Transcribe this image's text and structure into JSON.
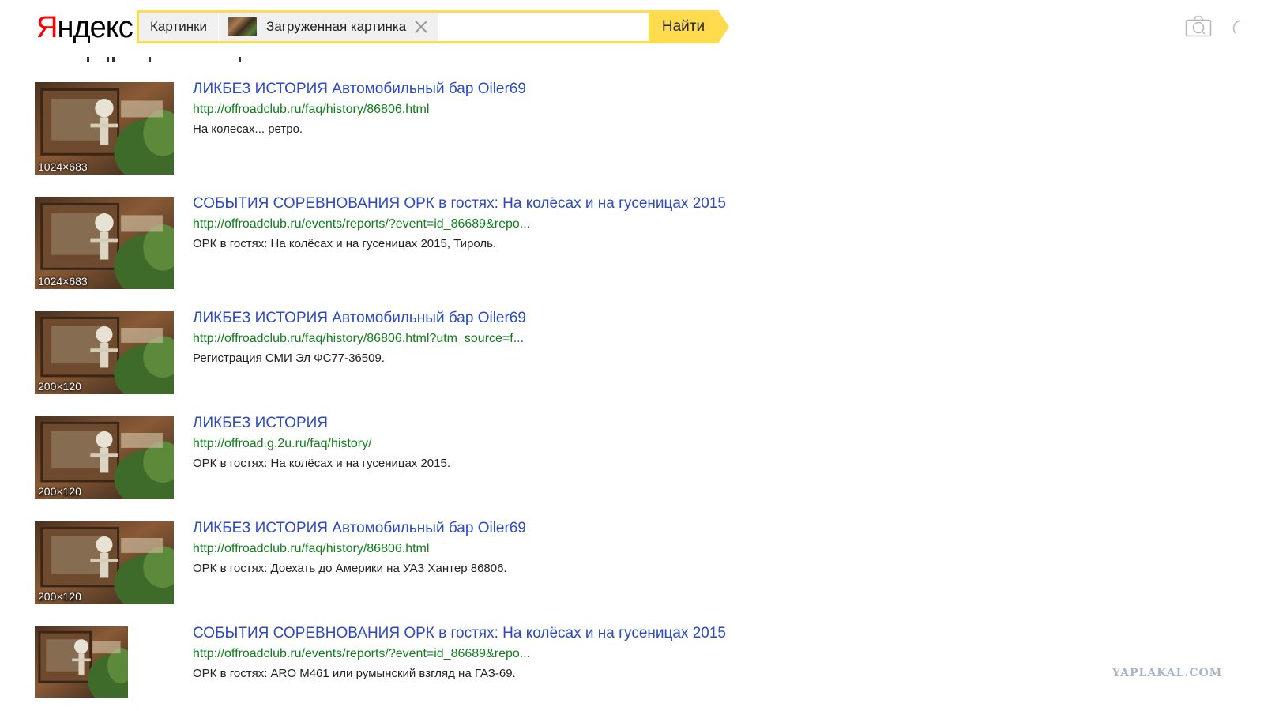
{
  "logo": {
    "part1": "Я",
    "part2": "ндекс"
  },
  "search": {
    "section_tag": "Картинки",
    "image_tag": "Загруженная картинка",
    "input_value": "",
    "find_label": "Найти"
  },
  "header_icons": [
    "camera-icon",
    "cut-off-icon"
  ],
  "results": [
    {
      "title": "ЛИКБЕЗ ИСТОРИЯ Автомобильный бар Oiler69",
      "url": "http://offroadclub.ru/faq/history/86806.html",
      "snippet": "На колесах... ретро.",
      "size": "1024×683"
    },
    {
      "title": "СОБЫТИЯ СОРЕВНОВАНИЯ ОРК в гостях: На колёсах и на гусеницах 2015",
      "url": "http://offroadclub.ru/events/reports/?event=id_86689&repo...",
      "snippet": "ОРК в гостях: На колёсах и на гусеницах 2015, Тироль.",
      "size": "1024×683"
    },
    {
      "title": "ЛИКБЕЗ ИСТОРИЯ Автомобильный бар Oiler69",
      "url": "http://offroadclub.ru/faq/history/86806.html?utm_source=f...",
      "snippet": "Регистрация СМИ Эл ФС77-36509.",
      "size": "200×120"
    },
    {
      "title": "ЛИКБЕЗ ИСТОРИЯ",
      "url": "http://offroad.g.2u.ru/faq/history/",
      "snippet": "ОРК в гостях: На колёсах и на гусеницах 2015.",
      "size": "200×120"
    },
    {
      "title": "ЛИКБЕЗ ИСТОРИЯ Автомобильный бар Oiler69",
      "url": "http://offroadclub.ru/faq/history/86806.html",
      "snippet": "ОРК в гостях: Доехать до Америки на УАЗ Хантер 86806.",
      "size": "200×120"
    },
    {
      "title": "СОБЫТИЯ СОРЕВНОВАНИЯ ОРК в гостях: На колёсах и на гусеницах 2015",
      "url": "http://offroadclub.ru/events/reports/?event=id_86689&repo...",
      "snippet": "ОРК в гостях: ARO M461 или румынский взгляд на ГАЗ-69.",
      "size": ""
    }
  ],
  "watermark": "YAPLAKAL.COM",
  "colors": {
    "accent_yellow": "#ffdb4d",
    "link_blue": "#2b4ac3",
    "url_green": "#107f1c",
    "logo_red": "#ff0000"
  }
}
